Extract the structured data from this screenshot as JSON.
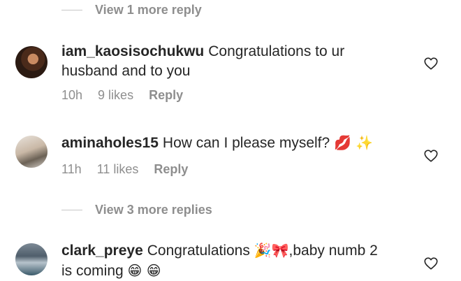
{
  "top_view_more": "View 1 more reply",
  "comments": [
    {
      "username": "iam_kaosisochukwu",
      "text": "Congratulations to ur husband and to you",
      "emoji": "",
      "time": "10h",
      "likes": "9 likes",
      "reply": "Reply"
    },
    {
      "username": "aminaholes15",
      "text": "How can I please myself?",
      "emoji": "💋 ✨",
      "time": "11h",
      "likes": "11 likes",
      "reply": "Reply"
    },
    {
      "username": "clark_preye",
      "text_part1": "Congratulations",
      "emoji_part1": "🎉🎀",
      "text_part2": ",baby numb 2 is coming",
      "emoji_part2": "😁 😁"
    }
  ],
  "middle_view_more": "View 3 more replies",
  "icons": {
    "like": "heart-icon"
  }
}
